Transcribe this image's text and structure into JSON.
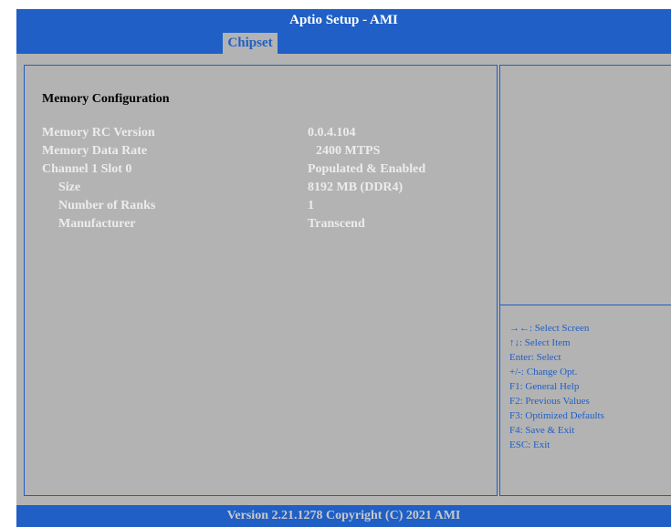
{
  "header": {
    "title": "Aptio Setup - AMI"
  },
  "tabs": [
    {
      "label": "Chipset",
      "selected": true
    }
  ],
  "main": {
    "section_title": "Memory Configuration",
    "rows": [
      {
        "label": "Memory RC Version",
        "value": "0.0.4.104"
      },
      {
        "label": "Memory Data Rate",
        "value": "2400 MTPS"
      },
      {
        "label": "Channel 1 Slot 0",
        "value": "Populated & Enabled"
      },
      {
        "label": "Size",
        "value": "8192 MB (DDR4)"
      },
      {
        "label": "Number of Ranks",
        "value": "1"
      },
      {
        "label": "Manufacturer",
        "value": "Transcend"
      }
    ]
  },
  "help": {
    "items": [
      "→←: Select Screen",
      "↑↓: Select Item",
      "Enter: Select",
      "+/-: Change Opt.",
      "F1: General Help",
      "F2: Previous Values",
      "F3: Optimized Defaults",
      "F4: Save & Exit",
      "ESC: Exit"
    ]
  },
  "footer": {
    "text": "Version 2.21.1278 Copyright (C) 2021 AMI"
  },
  "colors": {
    "accent": "#1f5fc6",
    "background": "#b3b3b3",
    "highlight_text": "#ececec"
  }
}
